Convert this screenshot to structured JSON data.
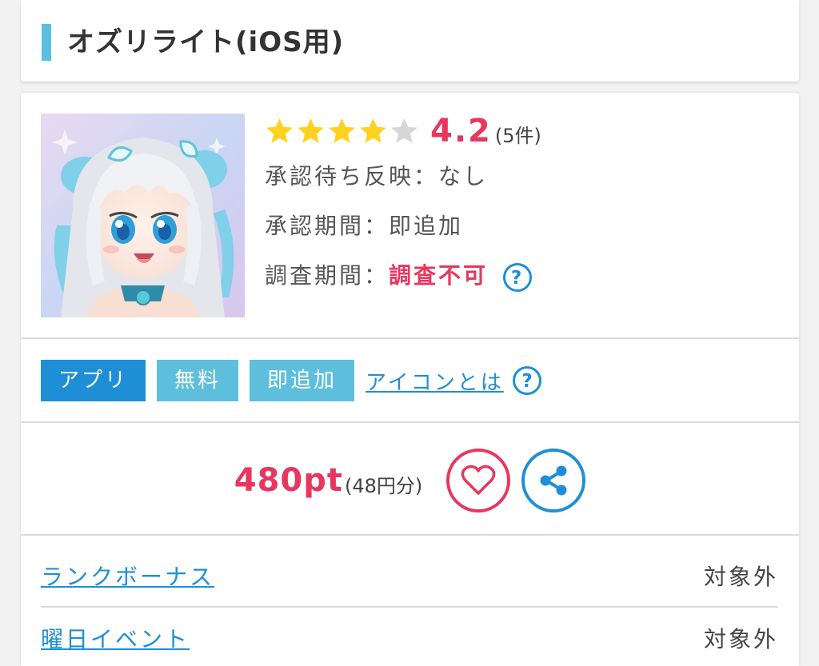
{
  "header": {
    "title": "オズリライト(iOS用)"
  },
  "app": {
    "icon_name": "app-character-icon",
    "rating": {
      "value": "4.2",
      "stars_filled": 4,
      "stars_total": 5,
      "count": "(5件)"
    },
    "info": [
      {
        "label": "承認待ち反映：",
        "value": "なし",
        "emphasis": false
      },
      {
        "label": "承認期間：",
        "value": "即追加",
        "emphasis": false
      },
      {
        "label": "調査期間：",
        "value": "調査不可",
        "emphasis": true
      }
    ]
  },
  "tags": {
    "items": [
      "アプリ",
      "無料",
      "即追加"
    ],
    "link": "アイコンとは"
  },
  "points": {
    "value": "480pt",
    "yen": "(48円分)"
  },
  "details": [
    {
      "label": "ランクボーナス",
      "value": "対象外"
    },
    {
      "label": "曜日イベント",
      "value": "対象外"
    }
  ],
  "colors": {
    "accent_red": "#e8375e",
    "accent_blue": "#1e8fd6",
    "tag_light": "#5ebfdc",
    "title_bar": "#5bc0de",
    "star": "#ffd21f"
  }
}
